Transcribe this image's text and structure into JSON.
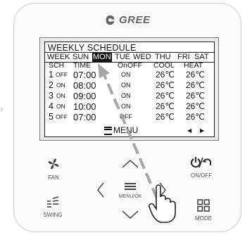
{
  "brand": {
    "name": "GREE",
    "logo_icon": "gree-logo-icon"
  },
  "screen": {
    "title": "WEEKLY SCHEDULE",
    "days": [
      "WEEK",
      "SUN",
      "MON",
      "TUE",
      "WED",
      "THU",
      "FRI",
      "SAT"
    ],
    "selected_day": "MON",
    "headers": {
      "sch": "SCH",
      "time": "TIME",
      "onoff": "OnOFF",
      "cool": "COOL",
      "heat": "HEAT"
    },
    "rows": [
      {
        "num": "1",
        "state": "OFF",
        "time": "07:00",
        "mode": "ON",
        "cool": "26℃",
        "heat": "26℃"
      },
      {
        "num": "2",
        "state": "ON",
        "time": "08:00",
        "mode": "ON",
        "cool": "26℃",
        "heat": "26℃"
      },
      {
        "num": "3",
        "state": "ON",
        "time": "09:00",
        "mode": "ON",
        "cool": "26℃",
        "heat": "26℃"
      },
      {
        "num": "4",
        "state": "ON",
        "time": "10:00",
        "mode": "ON",
        "cool": "26℃",
        "heat": "26℃"
      },
      {
        "num": "5",
        "state": "OFF",
        "time": "07:00",
        "mode": "OFF",
        "cool": "26℃",
        "heat": "26℃"
      }
    ],
    "menu_label": "MENU",
    "nav_left": "◀",
    "nav_right": "▶"
  },
  "buttons": {
    "fan": "FAN",
    "onoff": "ON/OFF",
    "menu_ok": "MENU/OK",
    "swing": "SWING",
    "mode": "MODE"
  }
}
